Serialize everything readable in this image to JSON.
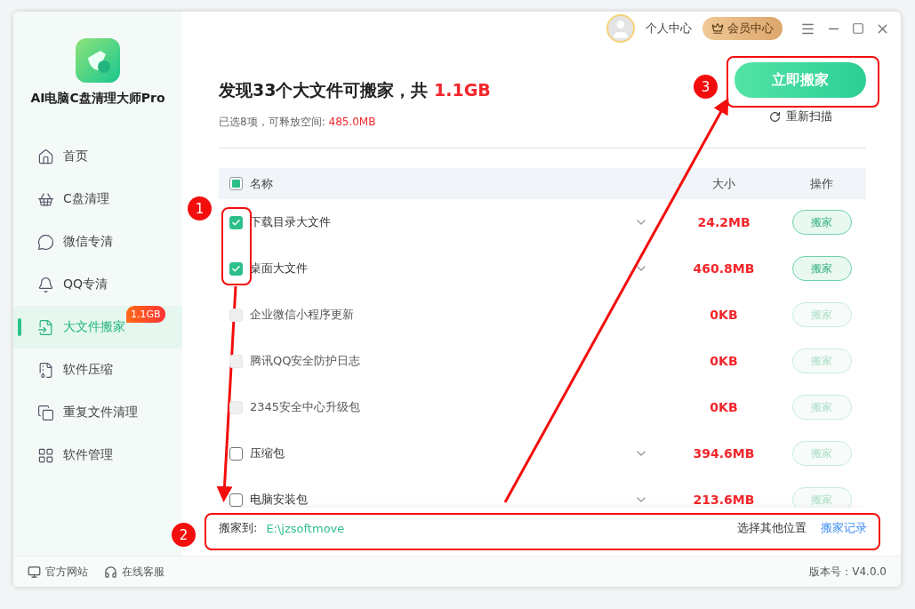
{
  "app": {
    "name": "AI电脑C盘清理大师Pro"
  },
  "sidebar": {
    "items": [
      {
        "label": "首页",
        "selected": false
      },
      {
        "label": "C盘清理",
        "selected": false
      },
      {
        "label": "微信专清",
        "selected": false
      },
      {
        "label": "QQ专清",
        "selected": false
      },
      {
        "label": "大文件搬家",
        "selected": true,
        "badge": "1.1GB"
      },
      {
        "label": "软件压缩",
        "selected": false
      },
      {
        "label": "重复文件清理",
        "selected": false
      },
      {
        "label": "软件管理",
        "selected": false
      }
    ]
  },
  "topbar": {
    "profile": "个人中心",
    "member": "会员中心"
  },
  "header": {
    "title": "发现33个大文件可搬家，共",
    "total": "1.1GB",
    "summary": "已选8项，可释放空间:",
    "freeable": "485.0MB",
    "primary_button": "立即搬家",
    "rescan": "重新扫描"
  },
  "table": {
    "columns": [
      {
        "label": "名称",
        "partial": true
      },
      {
        "label": "大小"
      },
      {
        "label": "操作"
      }
    ],
    "rows": [
      {
        "name": "下载目录大文件",
        "size": "24.2MB",
        "action": "搬家",
        "checked": true,
        "disabled": false,
        "expandable": true
      },
      {
        "name": "桌面大文件",
        "size": "460.8MB",
        "action": "搬家",
        "checked": true,
        "disabled": false,
        "expandable": true
      },
      {
        "name": "企业微信小程序更新",
        "size": "0KB",
        "action": "搬家",
        "checked": false,
        "disabled": true,
        "expandable": false
      },
      {
        "name": "腾讯QQ安全防护日志",
        "size": "0KB",
        "action": "搬家",
        "checked": false,
        "disabled": true,
        "expandable": false
      },
      {
        "name": "2345安全中心升级包",
        "size": "0KB",
        "action": "搬家",
        "checked": false,
        "disabled": true,
        "expandable": false
      },
      {
        "name": "压缩包",
        "size": "394.6MB",
        "action": "搬家",
        "checked": false,
        "disabled": false,
        "expandable": true
      },
      {
        "name": "电脑安装包",
        "size": "213.6MB",
        "action": "搬家",
        "checked": false,
        "disabled": false,
        "expandable": true
      }
    ]
  },
  "destination": {
    "label": "搬家到:",
    "path": "E:\\jzsoftmove",
    "choose": "选择其他位置",
    "history": "搬家记录"
  },
  "footer": {
    "website": "官方网站",
    "support": "在线客服",
    "version": "版本号：V4.0.0"
  },
  "annotations": [
    {
      "label": "1"
    },
    {
      "label": "2"
    },
    {
      "label": "3"
    }
  ]
}
